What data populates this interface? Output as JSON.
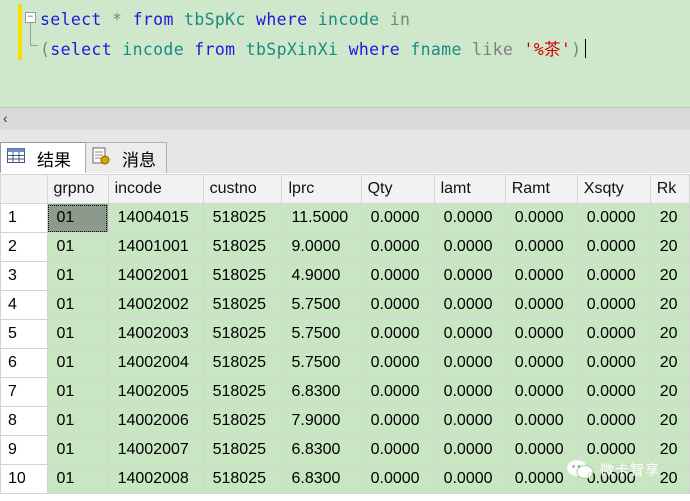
{
  "editor": {
    "line1": [
      "select",
      "*",
      "from",
      "tbSpKc",
      "where",
      "incode",
      "in"
    ],
    "line2": [
      "(",
      "select",
      "incode",
      "from",
      "tbSpXinXi",
      "where",
      "fname",
      "like",
      "'%茶'",
      ")"
    ]
  },
  "tabs": [
    {
      "label": "结果",
      "icon": "grid-icon"
    },
    {
      "label": "消息",
      "icon": "messages-icon"
    }
  ],
  "grid": {
    "columns": [
      "",
      "grpno",
      "incode",
      "custno",
      "lprc",
      "Qty",
      "lamt",
      "Ramt",
      "Xsqty",
      "Rk"
    ],
    "rows": [
      [
        "1",
        "01",
        "14004015",
        "518025",
        "11.5000",
        "0.0000",
        "0.0000",
        "0.0000",
        "0.0000",
        "20"
      ],
      [
        "2",
        "01",
        "14001001",
        "518025",
        "9.0000",
        "0.0000",
        "0.0000",
        "0.0000",
        "0.0000",
        "20"
      ],
      [
        "3",
        "01",
        "14002001",
        "518025",
        "4.9000",
        "0.0000",
        "0.0000",
        "0.0000",
        "0.0000",
        "20"
      ],
      [
        "4",
        "01",
        "14002002",
        "518025",
        "5.7500",
        "0.0000",
        "0.0000",
        "0.0000",
        "0.0000",
        "20"
      ],
      [
        "5",
        "01",
        "14002003",
        "518025",
        "5.7500",
        "0.0000",
        "0.0000",
        "0.0000",
        "0.0000",
        "20"
      ],
      [
        "6",
        "01",
        "14002004",
        "518025",
        "5.7500",
        "0.0000",
        "0.0000",
        "0.0000",
        "0.0000",
        "20"
      ],
      [
        "7",
        "01",
        "14002005",
        "518025",
        "6.8300",
        "0.0000",
        "0.0000",
        "0.0000",
        "0.0000",
        "20"
      ],
      [
        "8",
        "01",
        "14002006",
        "518025",
        "7.9000",
        "0.0000",
        "0.0000",
        "0.0000",
        "0.0000",
        "20"
      ],
      [
        "9",
        "01",
        "14002007",
        "518025",
        "6.8300",
        "0.0000",
        "0.0000",
        "0.0000",
        "0.0000",
        "20"
      ],
      [
        "10",
        "01",
        "14002008",
        "518025",
        "6.8300",
        "0.0000",
        "0.0000",
        "0.0000",
        "0.0000",
        "20"
      ]
    ]
  },
  "watermark": {
    "text": "微卡智享"
  }
}
